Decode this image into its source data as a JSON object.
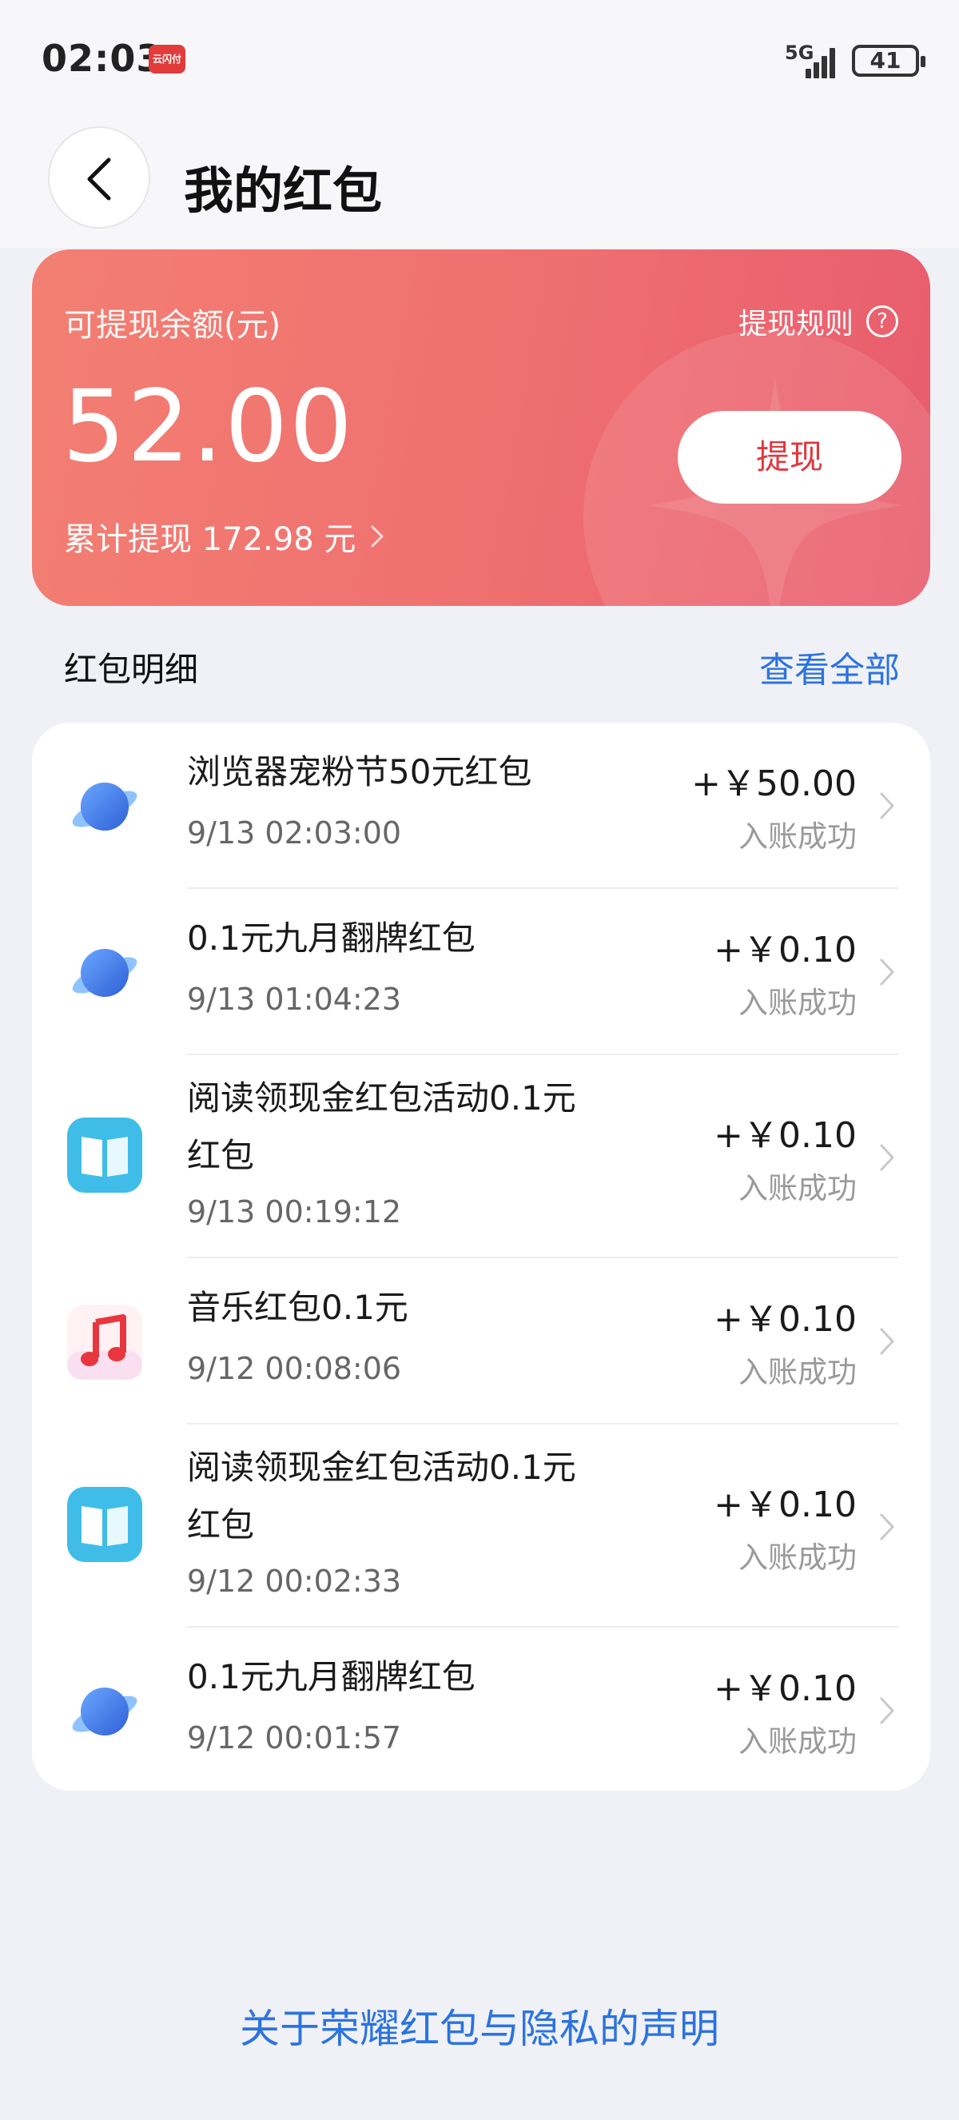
{
  "status_bar": {
    "time": "02:03",
    "app_badge": "云闪付",
    "network": "5G",
    "battery": "41"
  },
  "header": {
    "title": "我的红包"
  },
  "balance": {
    "label": "可提现余额(元)",
    "rules_label": "提现规则",
    "amount": "52.00",
    "withdraw_label": "提现",
    "cumulative": "累计提现 172.98 元"
  },
  "details": {
    "title": "红包明细",
    "view_all": "查看全部"
  },
  "transactions": [
    {
      "icon": "browser-planet-icon",
      "title": "浏览器宠粉节50元红包",
      "time": "9/13 02:03:00",
      "amount": "+￥50.00",
      "status": "入账成功"
    },
    {
      "icon": "browser-planet-icon",
      "title": "0.1元九月翻牌红包",
      "time": "9/13 01:04:23",
      "amount": "+￥0.10",
      "status": "入账成功"
    },
    {
      "icon": "book-icon",
      "title": "阅读领现金红包活动0.1元红包",
      "time": "9/13 00:19:12",
      "amount": "+￥0.10",
      "status": "入账成功"
    },
    {
      "icon": "music-note-icon",
      "title": "音乐红包0.1元",
      "time": "9/12 00:08:06",
      "amount": "+￥0.10",
      "status": "入账成功"
    },
    {
      "icon": "book-icon",
      "title": "阅读领现金红包活动0.1元红包",
      "time": "9/12 00:02:33",
      "amount": "+￥0.10",
      "status": "入账成功"
    },
    {
      "icon": "browser-planet-icon",
      "title": "0.1元九月翻牌红包",
      "time": "9/12 00:01:57",
      "amount": "+￥0.10",
      "status": "入账成功"
    }
  ],
  "footer": {
    "privacy_link": "关于荣耀红包与隐私的声明"
  },
  "colors": {
    "accent_blue": "#2b73e0",
    "card_red": "#ef6f70",
    "withdraw_text": "#e0383f"
  }
}
